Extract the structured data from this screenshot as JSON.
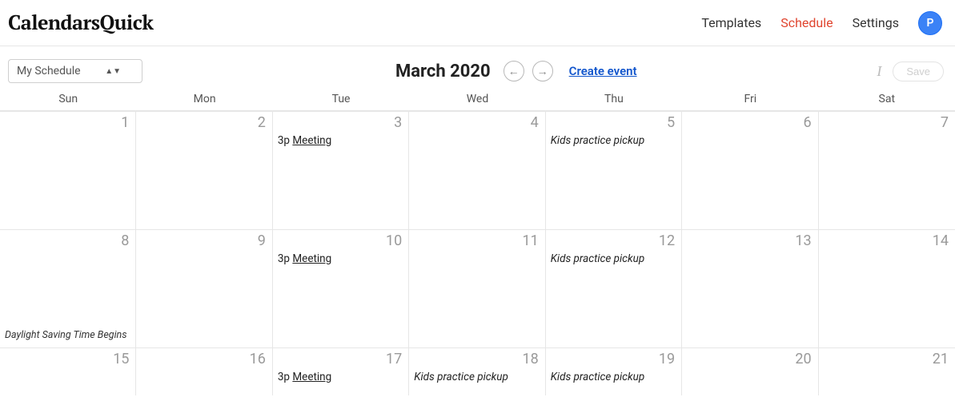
{
  "header": {
    "brand": "CalendarsQuick",
    "nav": {
      "templates": "Templates",
      "schedule": "Schedule",
      "settings": "Settings"
    },
    "avatar_letter": "P"
  },
  "toolbar": {
    "schedule_selected": "My Schedule",
    "month_title": "March 2020",
    "create_label": "Create event",
    "italic_label": "I",
    "save_label": "Save"
  },
  "dow": [
    "Sun",
    "Mon",
    "Tue",
    "Wed",
    "Thu",
    "Fri",
    "Sat"
  ],
  "weeks": [
    {
      "days": [
        {
          "num": "1",
          "events": [],
          "note": ""
        },
        {
          "num": "2",
          "events": [],
          "note": ""
        },
        {
          "num": "3",
          "events": [
            {
              "time": "3p",
              "text": "Meeting",
              "underlined": true
            }
          ],
          "note": ""
        },
        {
          "num": "4",
          "events": [],
          "note": ""
        },
        {
          "num": "5",
          "events": [
            {
              "time": "",
              "text": "Kids practice pickup",
              "underlined": false
            }
          ],
          "note": ""
        },
        {
          "num": "6",
          "events": [],
          "note": ""
        },
        {
          "num": "7",
          "events": [],
          "note": ""
        }
      ]
    },
    {
      "days": [
        {
          "num": "8",
          "events": [],
          "note": "Daylight Saving Time Begins"
        },
        {
          "num": "9",
          "events": [],
          "note": ""
        },
        {
          "num": "10",
          "events": [
            {
              "time": "3p",
              "text": "Meeting",
              "underlined": true
            }
          ],
          "note": ""
        },
        {
          "num": "11",
          "events": [],
          "note": ""
        },
        {
          "num": "12",
          "events": [
            {
              "time": "",
              "text": "Kids practice pickup",
              "underlined": false
            }
          ],
          "note": ""
        },
        {
          "num": "13",
          "events": [],
          "note": ""
        },
        {
          "num": "14",
          "events": [],
          "note": ""
        }
      ]
    },
    {
      "days": [
        {
          "num": "15",
          "events": [],
          "note": ""
        },
        {
          "num": "16",
          "events": [],
          "note": ""
        },
        {
          "num": "17",
          "events": [
            {
              "time": "3p",
              "text": "Meeting",
              "underlined": true
            }
          ],
          "note": ""
        },
        {
          "num": "18",
          "events": [
            {
              "time": "",
              "text": "Kids practice pickup",
              "underlined": false
            }
          ],
          "note": ""
        },
        {
          "num": "19",
          "events": [
            {
              "time": "",
              "text": "Kids practice pickup",
              "underlined": false
            }
          ],
          "note": ""
        },
        {
          "num": "20",
          "events": [],
          "note": ""
        },
        {
          "num": "21",
          "events": [],
          "note": ""
        }
      ]
    }
  ]
}
